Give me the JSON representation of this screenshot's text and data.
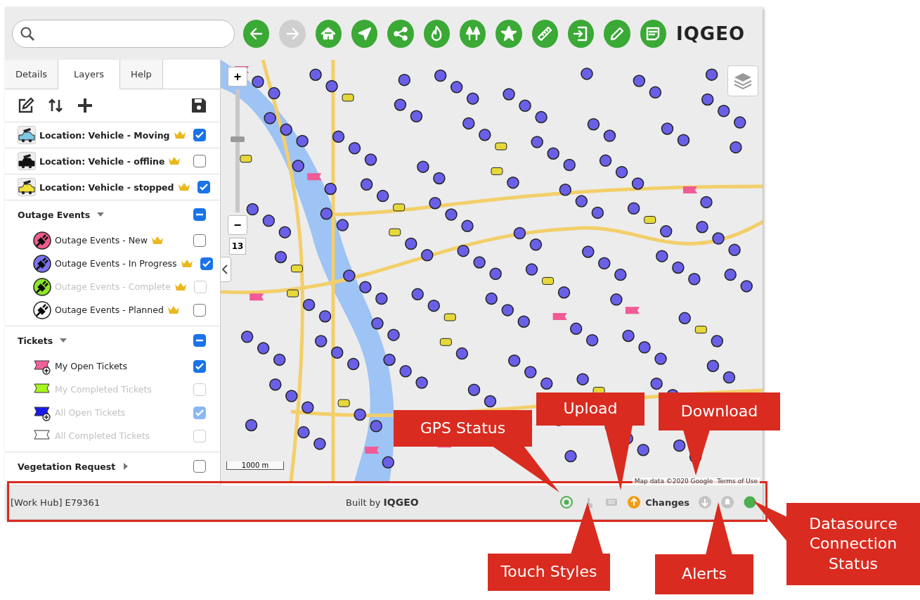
{
  "toolbar": {
    "buttons": [
      {
        "kind": "back",
        "disabled": false
      },
      {
        "kind": "forward",
        "disabled": true
      },
      {
        "kind": "home",
        "disabled": false
      },
      {
        "kind": "locate",
        "disabled": false
      },
      {
        "kind": "share",
        "disabled": false
      },
      {
        "kind": "fire",
        "disabled": false
      },
      {
        "kind": "trees",
        "disabled": false
      },
      {
        "kind": "star",
        "disabled": false
      },
      {
        "kind": "ruler",
        "disabled": false
      },
      {
        "kind": "import",
        "disabled": false
      },
      {
        "kind": "pencil",
        "disabled": false
      },
      {
        "kind": "notes",
        "disabled": false
      }
    ],
    "logo": "IQGEO"
  },
  "tabs": [
    {
      "label": "Details",
      "selected": false
    },
    {
      "label": "Layers",
      "selected": true
    },
    {
      "label": "Help",
      "selected": false
    }
  ],
  "layers": [
    {
      "kind": "vehicle",
      "color": "#7ec8e3",
      "label": "Location: Vehicle - Moving",
      "premium": true,
      "checked": true,
      "disabled": false
    },
    {
      "kind": "vehicle",
      "color": "#111111",
      "label": "Location: Vehicle - offline",
      "premium": true,
      "checked": false,
      "disabled": false
    },
    {
      "kind": "vehicle",
      "color": "#f2e03a",
      "label": "Location: Vehicle - stopped",
      "premium": true,
      "checked": true,
      "disabled": false
    },
    {
      "kind": "group",
      "label": "Outage Events",
      "expanded": true,
      "indeterminate": true,
      "children": [
        {
          "kind": "outage",
          "color": "#ef5b8c",
          "label": "Outage Events - New",
          "premium": true,
          "checked": false,
          "disabled": false
        },
        {
          "kind": "outage",
          "color": "#7a73f0",
          "label": "Outage Events - In Progress",
          "premium": true,
          "checked": true,
          "disabled": false
        },
        {
          "kind": "outage",
          "color": "#8ee62c",
          "label": "Outage Events - Complete",
          "premium": true,
          "checked": false,
          "disabled": true
        },
        {
          "kind": "outage",
          "color": "#ffffff",
          "label": "Outage Events - Planned",
          "premium": true,
          "checked": false,
          "disabled": false
        }
      ]
    },
    {
      "kind": "group",
      "label": "Tickets",
      "expanded": true,
      "indeterminate": true,
      "children": [
        {
          "kind": "open-ticket",
          "color": "#f4619a",
          "label": "My Open Tickets",
          "premium": false,
          "checked": true,
          "disabled": false
        },
        {
          "kind": "closed-ticket",
          "color": "#a6f51c",
          "label": "My Completed Tickets",
          "premium": false,
          "checked": false,
          "disabled": true
        },
        {
          "kind": "open-ticket",
          "color": "#1a1ae8",
          "label": "All Open Tickets",
          "premium": false,
          "checked": true,
          "disabled": true
        },
        {
          "kind": "closed-ticket",
          "color": "#ffffff",
          "label": "All Completed Tickets",
          "premium": false,
          "checked": false,
          "disabled": true
        }
      ]
    },
    {
      "kind": "group",
      "label": "Vegetation Request",
      "expanded": false,
      "checked": false
    }
  ],
  "map": {
    "zoom_in": "+",
    "zoom_out": "−",
    "zoom_slider": {
      "level": 0.6
    },
    "zoom_level": "13",
    "scale": "1000 m",
    "attribution": "Map data ©2020 Google",
    "terms": "Terms of Use"
  },
  "status_bar": {
    "hub": "[Work Hub] E79361",
    "built_by": "Built by",
    "logo": "IQGEO",
    "icons": [
      {
        "kind": "gps",
        "active": true
      },
      {
        "kind": "touch",
        "active": false
      },
      {
        "kind": "keyboard",
        "active": false
      },
      {
        "kind": "upload",
        "active": true,
        "label": "Changes"
      },
      {
        "kind": "download",
        "active": false
      },
      {
        "kind": "alerts",
        "active": false
      },
      {
        "kind": "connection",
        "active": true
      }
    ]
  },
  "callouts": [
    {
      "text": "GPS Status"
    },
    {
      "text": "Upload"
    },
    {
      "text": "Download"
    },
    {
      "text": "Touch Styles"
    },
    {
      "text": "Alerts"
    },
    {
      "text": "Datasource Connection Status"
    }
  ]
}
